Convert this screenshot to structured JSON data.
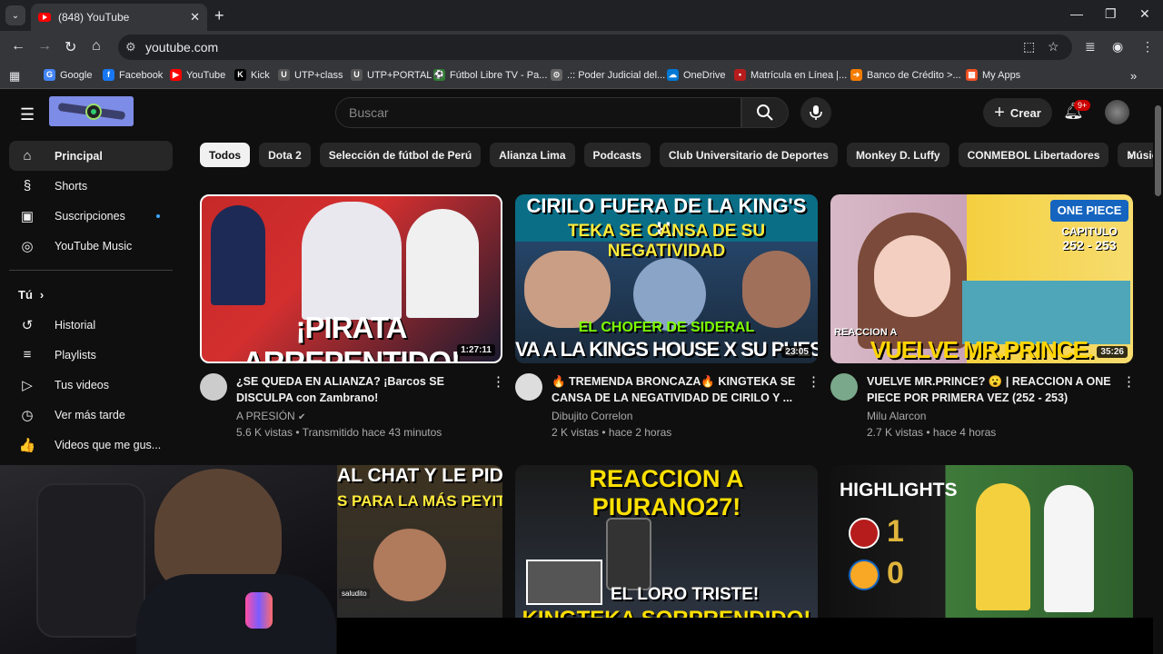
{
  "browser": {
    "tab_title": "(848) YouTube",
    "url": "youtube.com",
    "bookmarks": [
      {
        "label": "Google",
        "icon": "google-icon",
        "color": "#4285f4",
        "glyph": "G"
      },
      {
        "label": "Facebook",
        "icon": "facebook-icon",
        "color": "#1877f2",
        "glyph": "f"
      },
      {
        "label": "YouTube",
        "icon": "youtube-icon",
        "color": "#ff0000",
        "glyph": "▶"
      },
      {
        "label": "Kick",
        "icon": "kick-icon",
        "color": "#000000",
        "glyph": "K"
      },
      {
        "label": "UTP+class",
        "icon": "utp-icon",
        "color": "#555555",
        "glyph": "U"
      },
      {
        "label": "UTP+PORTAL",
        "icon": "utp-icon",
        "color": "#555555",
        "glyph": "U"
      },
      {
        "label": "Fútbol Libre TV - Pa...",
        "icon": "futbol-icon",
        "color": "#2e7d32",
        "glyph": "⚽"
      },
      {
        "label": ".:: Poder Judicial del...",
        "icon": "judicial-icon",
        "color": "#666666",
        "glyph": "⊙"
      },
      {
        "label": "OneDrive",
        "icon": "onedrive-icon",
        "color": "#0078d4",
        "glyph": "☁"
      },
      {
        "label": "Matrícula en Línea |...",
        "icon": "matricula-icon",
        "color": "#b71c1c",
        "glyph": "•"
      },
      {
        "label": "Banco de Crédito >...",
        "icon": "bcp-icon",
        "color": "#f57c00",
        "glyph": "➜"
      },
      {
        "label": "My Apps",
        "icon": "myapps-icon",
        "color": "#f25022",
        "glyph": "▦"
      }
    ]
  },
  "youtube": {
    "search_placeholder": "Buscar",
    "create_label": "Crear",
    "notif_badge": "9+",
    "sidebar": {
      "main": [
        {
          "label": "Principal",
          "icon": "home-icon",
          "glyph": "⌂",
          "active": true
        },
        {
          "label": "Shorts",
          "icon": "shorts-icon",
          "glyph": "§"
        },
        {
          "label": "Suscripciones",
          "icon": "subscriptions-icon",
          "glyph": "▣"
        },
        {
          "label": "YouTube Music",
          "icon": "music-icon",
          "glyph": "◎"
        }
      ],
      "you_label": "Tú",
      "you": [
        {
          "label": "Historial",
          "icon": "history-icon",
          "glyph": "↺"
        },
        {
          "label": "Playlists",
          "icon": "playlists-icon",
          "glyph": "≡"
        },
        {
          "label": "Tus videos",
          "icon": "your-videos-icon",
          "glyph": "▷"
        },
        {
          "label": "Ver más tarde",
          "icon": "watch-later-icon",
          "glyph": "◷"
        },
        {
          "label": "Videos que me gus...",
          "icon": "liked-icon",
          "glyph": "👍"
        }
      ]
    },
    "chips": [
      "Todos",
      "Dota 2",
      "Selección de fútbol de Perú",
      "Alianza Lima",
      "Podcasts",
      "Club Universitario de Deportes",
      "Monkey D. Luffy",
      "CONMEBOL Libertadores",
      "Música"
    ],
    "videos": [
      {
        "thumb_text": "¡PIRATA ARREPENTIDO!",
        "duration": "1:27:11",
        "title": "¿SE QUEDA EN ALIANZA? ¡Barcos SE DISCULPA con Zambrano!",
        "channel": "A PRESIÓN",
        "verified": true,
        "meta": "5.6 K vistas • Transmitido hace 43 minutos"
      },
      {
        "thumb_text_top": "CIRILO FUERA DE LA KING'S H.",
        "thumb_text_2": "TEKA SE CANSA DE SU NEGATIVIDAD",
        "thumb_text_3": "EL CHOFER DE SIDERAL",
        "thumb_text_bottom": "VA A LA KINGS HOUSE X SU PUESTO",
        "duration": "23:05",
        "title": "🔥 TREMENDA BRONCAZA🔥 KINGTEKA SE CANSA DE LA NEGATIVIDAD DE CIRILO Y ...",
        "channel": "Dibujito Correlon",
        "meta": "2 K vistas • hace 2 horas"
      },
      {
        "thumb_text_reaccion": "REACCION A",
        "thumb_text": "VUELVE MR.PRINCE.",
        "thumb_logo": "ONE PIECE",
        "thumb_cap": "CAPITULO",
        "thumb_cap_range": "252 - 253",
        "duration": "35:26",
        "title": "VUELVE MR.PRINCE? 😮 | REACCION A ONE PIECE POR PRIMERA VEZ  (252 - 253)",
        "channel": "Milu Alarcon",
        "meta": "2.7 K vistas • hace 4 horas"
      }
    ],
    "row2": {
      "a_text1": "AL CHAT Y LE PIDE",
      "a_text2": "S PARA LA MÁS PEYITA",
      "a_tag": "saludito",
      "b_text1": "REACCION A PIURANO27!",
      "b_text2": "EL LORO TRISTE!",
      "b_text3": "KINGTEKA SORPRENDIDO!",
      "c_title": "HIGHLIGHTS",
      "c_score1": "1",
      "c_score2": "0"
    }
  },
  "colors": {
    "accent": "#ff0000",
    "bg": "#0f0f0f"
  }
}
